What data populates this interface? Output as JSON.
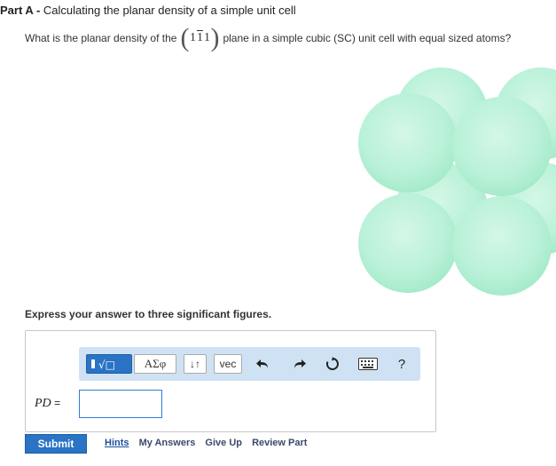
{
  "part": {
    "label": "Part A",
    "separator": " - ",
    "title": "Calculating the planar density of a simple unit cell"
  },
  "question": {
    "before": "What is the planar density of the",
    "miller_open": "(",
    "miller_h": "1",
    "miller_k": "1",
    "miller_l": "1",
    "miller_close": ")",
    "after": "plane in a simple cubic (SC) unit cell with equal sized atoms?"
  },
  "instruction": "Express your answer to three significant figures.",
  "toolbar": {
    "template_label": "√□",
    "greek_label": "ΑΣφ",
    "sort_label": "↓↑",
    "vec_label": "vec",
    "help_label": "?",
    "icons": [
      "fraction-radical-icon",
      "undo-icon",
      "redo-icon",
      "reset-icon",
      "keyboard-icon",
      "help-icon"
    ]
  },
  "answer": {
    "var_label": "PD",
    "equals": "=",
    "value": ""
  },
  "actions": {
    "submit": "Submit",
    "hints": "Hints",
    "my_answers": "My Answers",
    "give_up": "Give Up",
    "review_part": "Review Part"
  },
  "colors": {
    "atom": "#b9f1d8",
    "toolbar_bg": "#cfe2f4",
    "submit_bg": "#2a73c5",
    "input_border": "#2f7ed8"
  }
}
